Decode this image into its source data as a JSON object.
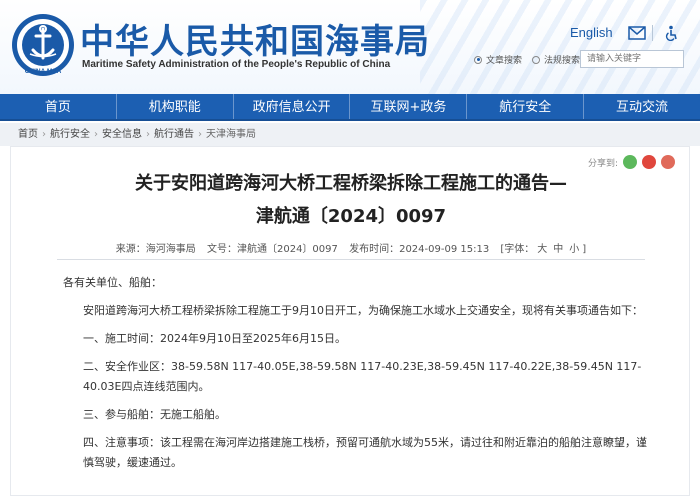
{
  "header": {
    "logo_text": "CHINA MSA",
    "logo_inner_text": "中华人民共和国海事局",
    "title": "中华人民共和国海事局",
    "subtitle": "Maritime Safety Administration of the People's Republic of China",
    "lang_link": "English",
    "icons": [
      "mail-icon",
      "accessibility-icon"
    ],
    "search_options": [
      "文章搜索",
      "法规搜索"
    ],
    "search_placeholder": "请输入关键字",
    "brand_color": "#1a5aa8"
  },
  "nav": {
    "items": [
      "首页",
      "机构职能",
      "政府信息公开",
      "互联网+政务",
      "航行安全",
      "互动交流"
    ],
    "color": "#1c5fb2"
  },
  "breadcrumb": {
    "items": [
      "首页",
      "航行安全",
      "安全信息",
      "航行通告",
      "天津海事局"
    ]
  },
  "article": {
    "share_label": "分享到:",
    "share_icons": [
      "wechat-icon",
      "weibo-icon",
      "qq-icon"
    ],
    "title_line1": "关于安阳道跨海河大桥工程桥梁拆除工程施工的通告—",
    "title_line2": "津航通〔2024〕0097",
    "meta": {
      "source": "来源：海河海事局",
      "doc_no": "文号：津航通〔2024〕0097",
      "published": "发布时间：2024-09-09 15:13",
      "font_label": "[字体：",
      "sizes": [
        "大",
        "中",
        "小"
      ],
      "close": "]"
    },
    "paragraphs": [
      "各有关单位、船舶：",
      "安阳道跨海河大桥工程桥梁拆除工程施工于9月10日开工，为确保施工水域水上交通安全，现将有关事项通告如下：",
      "一、施工时间：2024年9月10日至2025年6月15日。",
      "二、安全作业区：38-59.58N 117-40.05E,38-59.58N 117-40.23E,38-59.45N 117-40.22E,38-59.45N 117-40.03E四点连线范围内。",
      "三、参与船舶：无施工船舶。",
      "四、注意事项：该工程需在海河岸边搭建施工栈桥，预留可通航水域为55米，请过往和附近靠泊的船舶注意瞭望，谨慎驾驶，缓速通过。"
    ]
  }
}
